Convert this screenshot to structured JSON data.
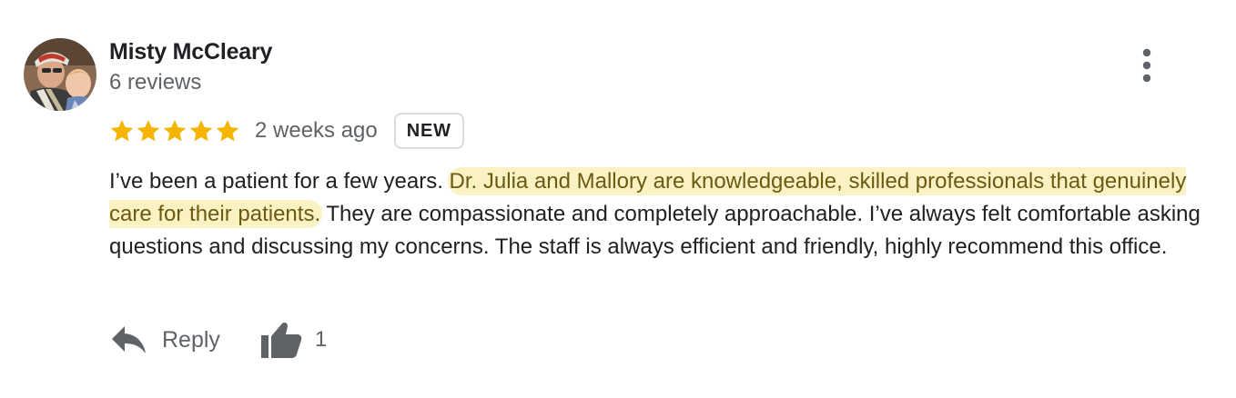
{
  "review": {
    "author": {
      "name": "Misty McCleary",
      "meta": "6 reviews"
    },
    "rating": 5,
    "time": "2 weeks ago",
    "badge": "NEW",
    "text": {
      "before": "I’ve been a patient for a few years. ",
      "highlight": "Dr. Julia and Mallory are knowledgeable, skilled professionals that genuinely care for their patients.",
      "after": " They are compassionate and completely approachable. I’ve always felt comfortable asking questions and discussing my concerns. The staff is always efficient and friendly, highly recommend this office."
    },
    "actions": {
      "reply_label": "Reply",
      "like_count": "1"
    }
  },
  "colors": {
    "star": "#f5b400",
    "highlight_bg": "#fbf2c4",
    "highlight_text": "#6b5a12",
    "meta_text": "#5f6368",
    "icon": "#5f6368"
  },
  "icons": {
    "more": "more-vert-icon",
    "reply": "reply-arrow-icon",
    "like": "thumb-up-icon",
    "star": "star-icon"
  }
}
